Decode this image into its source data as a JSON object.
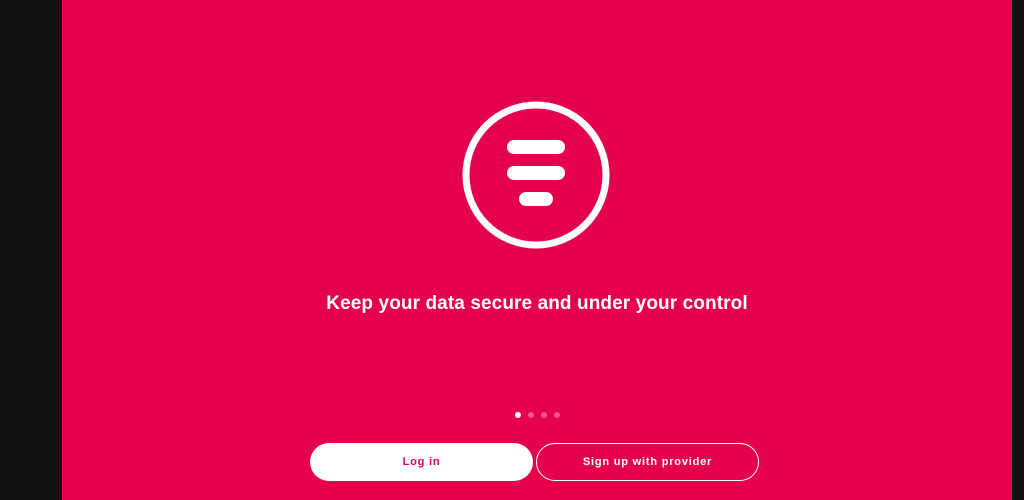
{
  "onboarding": {
    "tagline": "Keep your data secure and under your control",
    "logo_icon": "menu-lines-circle-icon",
    "pager": {
      "count": 4,
      "active_index": 0
    },
    "buttons": {
      "login_label": "Log in",
      "signup_label": "Sign up with provider"
    }
  },
  "colors": {
    "background": "#e5004f",
    "foreground": "#ffffff",
    "window_frame": "#111111"
  }
}
